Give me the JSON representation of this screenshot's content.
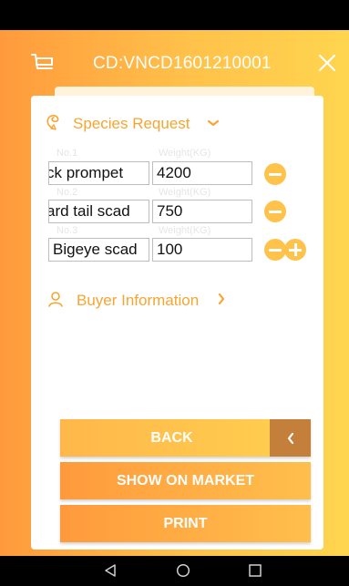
{
  "header": {
    "title": "CD:VNCD1601210001",
    "cart_icon": "cart-icon",
    "close_icon": "close-icon"
  },
  "species_section": {
    "title": "Species Request",
    "icon": "fish-icon",
    "expanded": true,
    "rows": [
      {
        "no_hint": "No.1",
        "weight_hint": "Weight(KG)",
        "species": "ck prompet",
        "weight": "4200",
        "actions": [
          "remove"
        ]
      },
      {
        "no_hint": "No.2",
        "weight_hint": "Weight(KG)",
        "species": "ard tail scad",
        "weight": "750",
        "actions": [
          "remove"
        ]
      },
      {
        "no_hint": "No.3",
        "weight_hint": "Weight(KG)",
        "species": "Bigeye scad",
        "weight": "100",
        "actions": [
          "remove",
          "add"
        ]
      }
    ]
  },
  "buyer_section": {
    "title": "Buyer Information",
    "icon": "person-icon",
    "expanded": false
  },
  "buttons": {
    "back": "BACK",
    "show_on_market": "SHOW ON MARKET",
    "print": "PRINT"
  },
  "nav": {
    "back_icon": "nav-back-icon",
    "home_icon": "nav-home-icon",
    "recents_icon": "nav-recents-icon"
  },
  "colors": {
    "accent": "#f7a531",
    "gradient_start": "#ff9a3c",
    "gradient_end": "#ffd54f",
    "back_chevron_box": "#c4803a"
  }
}
